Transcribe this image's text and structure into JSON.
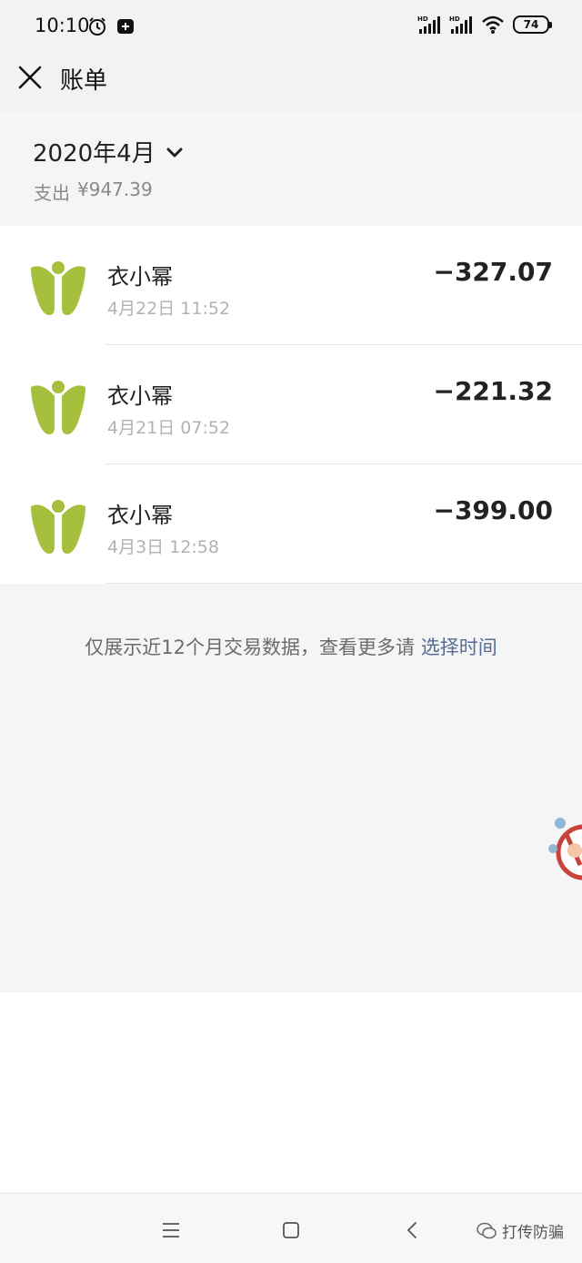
{
  "status_bar": {
    "time": "10:10",
    "battery": "74",
    "icons": [
      "alarm-icon",
      "notification-icon",
      "hd-signal-icon",
      "hd-signal-icon",
      "wifi-icon",
      "battery-icon"
    ]
  },
  "nav": {
    "title": "账单",
    "close_icon": "close-icon"
  },
  "summary": {
    "month": "2020年4月",
    "spend_label": "支出",
    "spend_amount": "¥947.39"
  },
  "transactions": [
    {
      "name": "衣小幂",
      "time": "4月22日 11:52",
      "amount": "−327.07"
    },
    {
      "name": "衣小幂",
      "time": "4月21日 07:52",
      "amount": "−221.32"
    },
    {
      "name": "衣小幂",
      "time": "4月3日 12:58",
      "amount": "−399.00"
    }
  ],
  "footer": {
    "note": "仅展示近12个月交易数据，查看更多请",
    "link": "选择时间"
  },
  "system_nav": {
    "watermark": "打传防骗"
  },
  "colors": {
    "logo_green": "#a6bf3c",
    "link_blue": "#576b95",
    "page_gray": "#f5f5f5"
  }
}
